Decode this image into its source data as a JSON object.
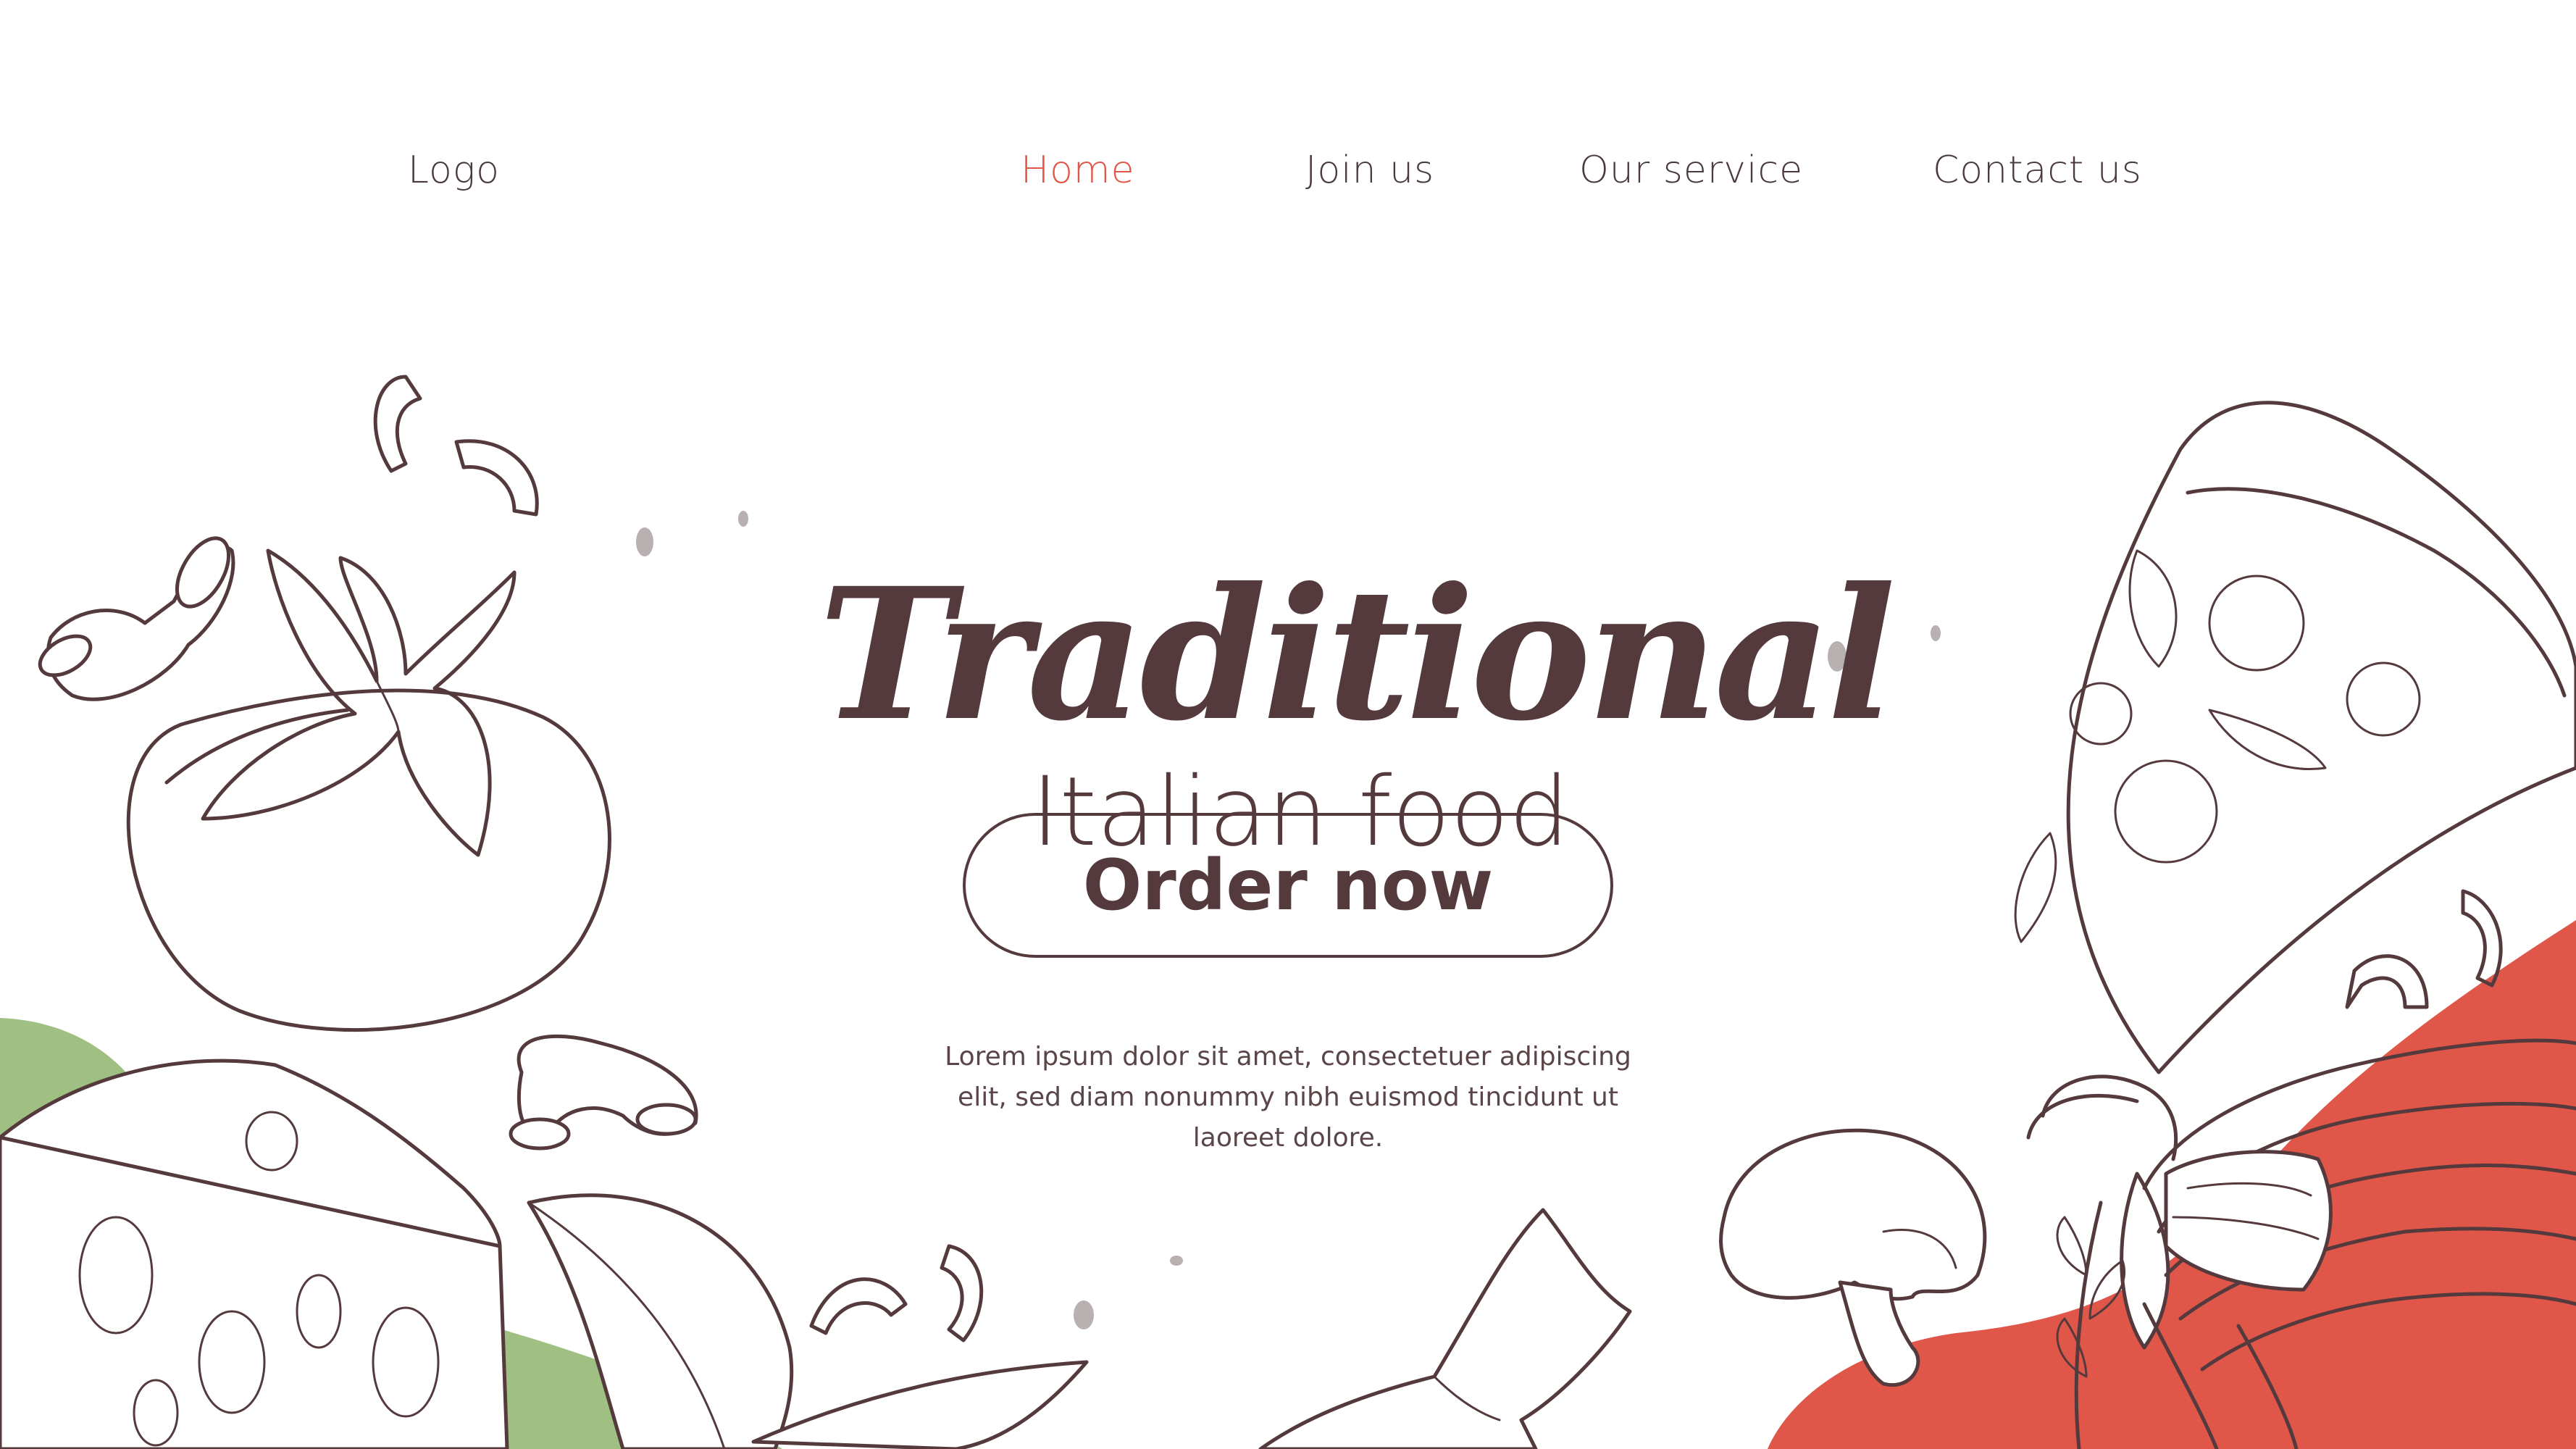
{
  "nav": {
    "logo": "Logo",
    "items": [
      {
        "label": "Home",
        "active": true
      },
      {
        "label": "Join us",
        "active": false
      },
      {
        "label": "Our service",
        "active": false
      },
      {
        "label": "Contact us",
        "active": false
      }
    ]
  },
  "hero": {
    "title": "Traditional",
    "subtitle": "Italian food",
    "cta_label": "Order now",
    "description": "Lorem ipsum dolor sit amet, consectetuer adipiscing elit, sed diam nonummy nibh euismod tincidunt ut laoreet dolore."
  },
  "colors": {
    "text": "#553a3d",
    "accent": "#e0574a",
    "green_blob": "#9fbf83",
    "red_blob": "#e0574a",
    "background": "#ffffff"
  },
  "illustrations": [
    "tomato-icon",
    "macaroni-icon",
    "cheese-icon",
    "basil-leaf-icon",
    "farfalle-icon",
    "mushroom-icon",
    "pizza-slice-icon",
    "spaghetti-icon",
    "herb-sprig-icon"
  ]
}
